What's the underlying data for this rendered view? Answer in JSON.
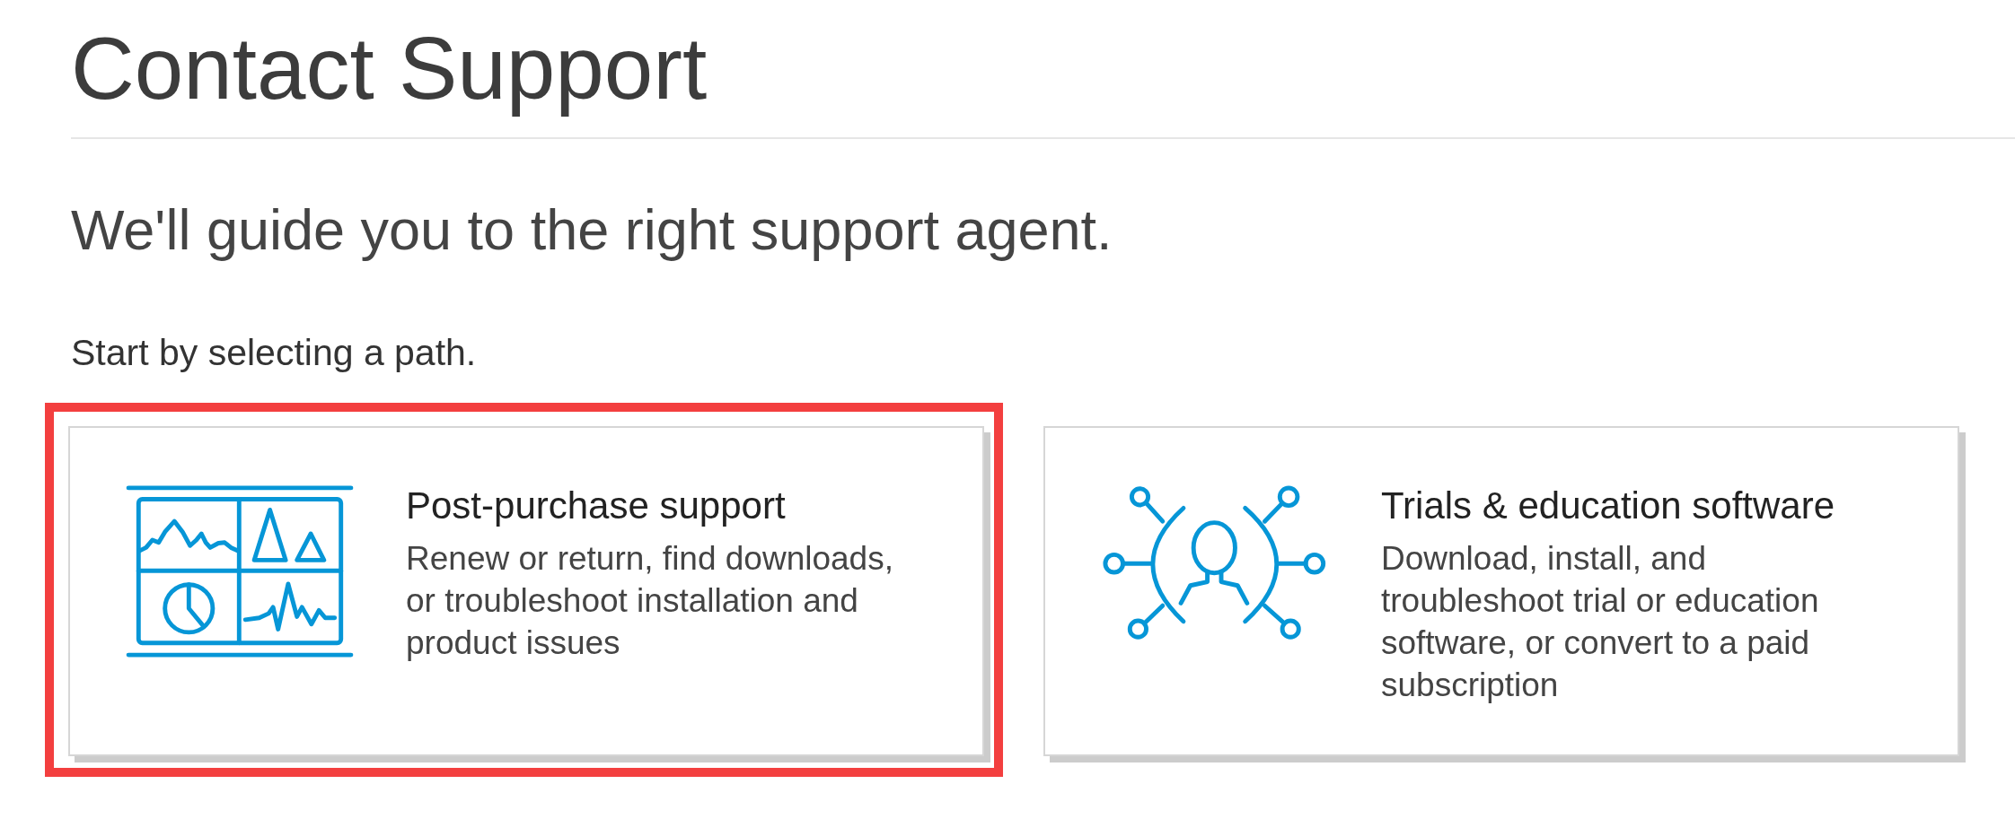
{
  "page": {
    "title": "Contact Support",
    "subtitle": "We'll guide you to the right support agent.",
    "prompt": "Start by selecting a path."
  },
  "paths": [
    {
      "kind": "dashboard",
      "title": "Post-purchase support",
      "description": "Renew or return, find downloads, or troubleshoot installation and product issues",
      "highlighted": true
    },
    {
      "kind": "person-network",
      "title": "Trials & education software",
      "description": "Download, install, and troubleshoot trial or education software, or convert to a paid subscription",
      "highlighted": false
    }
  ]
}
